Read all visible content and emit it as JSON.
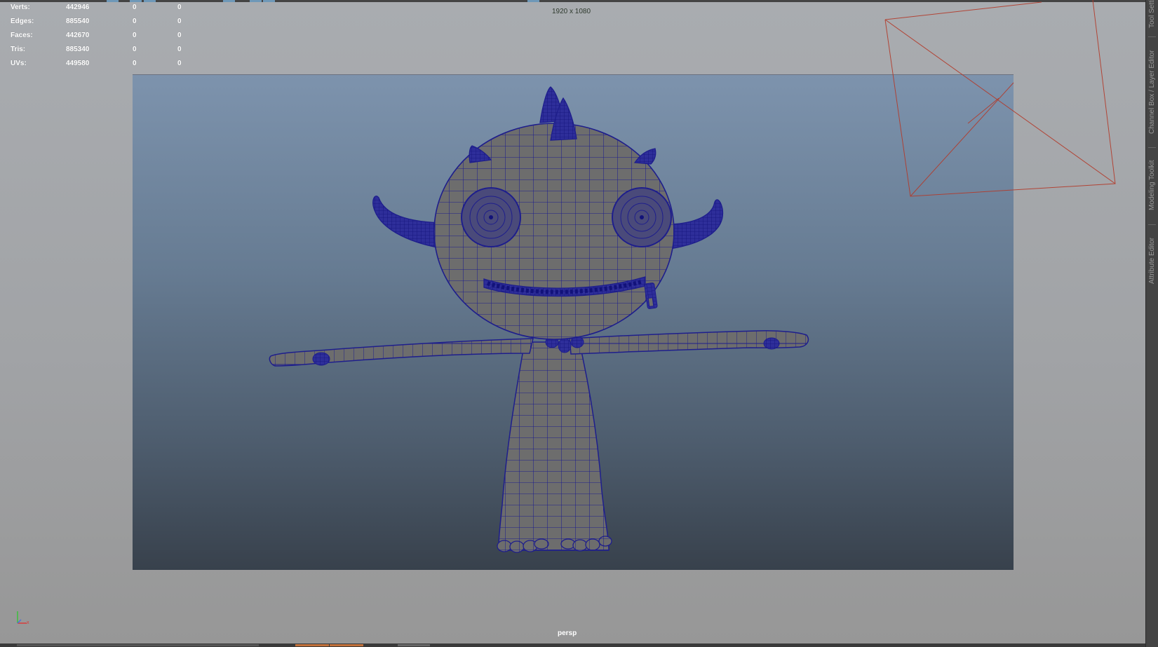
{
  "viewport": {
    "resolution": "1920 x 1080",
    "camera": "persp",
    "axis_icon": "xyz-axis-icon"
  },
  "hud": {
    "rows": [
      {
        "label": "Verts:",
        "total": "442946",
        "selected": "0",
        "component": "0"
      },
      {
        "label": "Edges:",
        "total": "885540",
        "selected": "0",
        "component": "0"
      },
      {
        "label": "Faces:",
        "total": "442670",
        "selected": "0",
        "component": "0"
      },
      {
        "label": "Tris:",
        "total": "885340",
        "selected": "0",
        "component": "0"
      },
      {
        "label": "UVs:",
        "total": "449580",
        "selected": "0",
        "component": "0"
      }
    ]
  },
  "side_panel": {
    "tabs": [
      "Tool Settings",
      "Channel Box / Layer Editor",
      "Modeling Toolkit",
      "Attribute Editor"
    ]
  },
  "colors": {
    "wireframe": "#1e1e8c",
    "mesh_fill": "#6d6d6d",
    "camera_gizmo": "#b33a2a"
  }
}
